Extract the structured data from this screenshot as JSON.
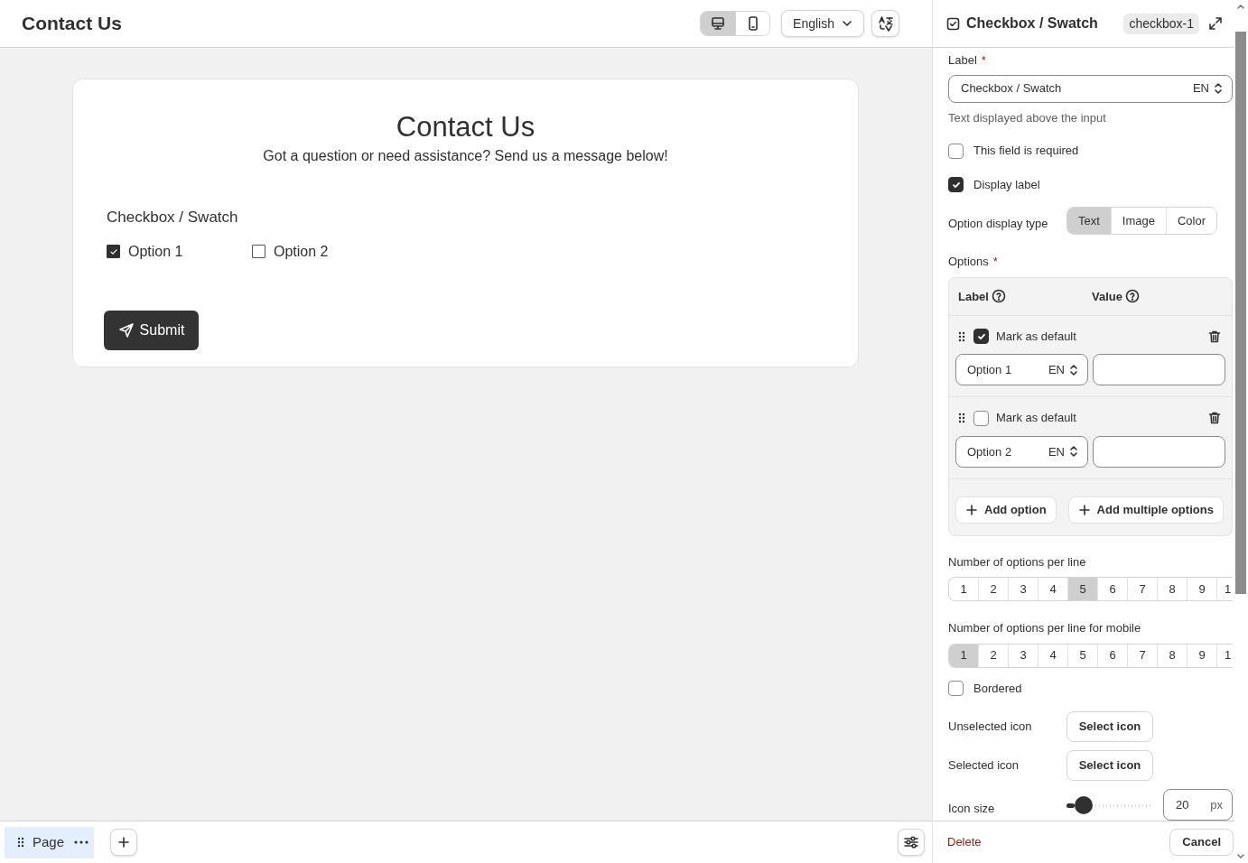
{
  "header": {
    "title": "Contact Us",
    "device_toggle": [
      {
        "kind": "desktop",
        "selected": true
      },
      {
        "kind": "mobile",
        "selected": false
      }
    ],
    "language": "English"
  },
  "form": {
    "title": "Contact Us",
    "subtitle": "Got a question or need assistance? Send us a message below!",
    "field_label": "Checkbox / Swatch",
    "options": [
      {
        "label": "Option 1",
        "checked": true
      },
      {
        "label": "Option 2",
        "checked": false
      }
    ],
    "submit": "Submit"
  },
  "bottom_bar": {
    "page_tab": "Page"
  },
  "panel": {
    "title": "Checkbox / Swatch",
    "id_badge": "checkbox-1",
    "label_field": {
      "label": "Label",
      "required_mark": "*",
      "value": "Checkbox / Swatch",
      "lang": "EN",
      "help": "Text displayed above the input"
    },
    "checkboxes": [
      {
        "label": "This field is required",
        "checked": false
      },
      {
        "label": "Display label",
        "checked": true
      }
    ],
    "display_type": {
      "label": "Option display type",
      "choices": [
        {
          "label": "Text",
          "selected": true
        },
        {
          "label": "Image",
          "selected": false
        },
        {
          "label": "Color",
          "selected": false
        }
      ]
    },
    "options": {
      "label": "Options",
      "required_mark": "*",
      "col_label": "Label",
      "col_value": "Value",
      "rows": [
        {
          "default_label": "Mark as default",
          "default": true,
          "label": "Option 1",
          "lang": "EN"
        },
        {
          "default_label": "Mark as default",
          "default": false,
          "label": "Option 2",
          "lang": "EN"
        }
      ],
      "add_option": "Add option",
      "add_multiple": "Add multiple options"
    },
    "per_line": {
      "label": "Number of options per line",
      "choices": [
        {
          "label": "1",
          "selected": false
        },
        {
          "label": "2",
          "selected": false
        },
        {
          "label": "3",
          "selected": false
        },
        {
          "label": "4",
          "selected": false
        },
        {
          "label": "5",
          "selected": true
        },
        {
          "label": "6",
          "selected": false
        },
        {
          "label": "7",
          "selected": false
        },
        {
          "label": "8",
          "selected": false
        },
        {
          "label": "9",
          "selected": false
        },
        {
          "label": "1",
          "selected": false
        }
      ]
    },
    "per_line_mobile": {
      "label": "Number of options per line for mobile",
      "choices": [
        {
          "label": "1",
          "selected": true
        },
        {
          "label": "2",
          "selected": false
        },
        {
          "label": "3",
          "selected": false
        },
        {
          "label": "4",
          "selected": false
        },
        {
          "label": "5",
          "selected": false
        },
        {
          "label": "6",
          "selected": false
        },
        {
          "label": "7",
          "selected": false
        },
        {
          "label": "8",
          "selected": false
        },
        {
          "label": "9",
          "selected": false
        },
        {
          "label": "1",
          "selected": false
        }
      ]
    },
    "bordered": {
      "label": "Bordered",
      "checked": false
    },
    "icon_rows": [
      {
        "label": "Unselected icon",
        "button": "Select icon"
      },
      {
        "label": "Selected icon",
        "button": "Select icon"
      }
    ],
    "icon_size": {
      "label": "Icon size",
      "level": 0.2,
      "value": "20",
      "unit": "px"
    },
    "delete": "Delete",
    "cancel": "Cancel"
  }
}
